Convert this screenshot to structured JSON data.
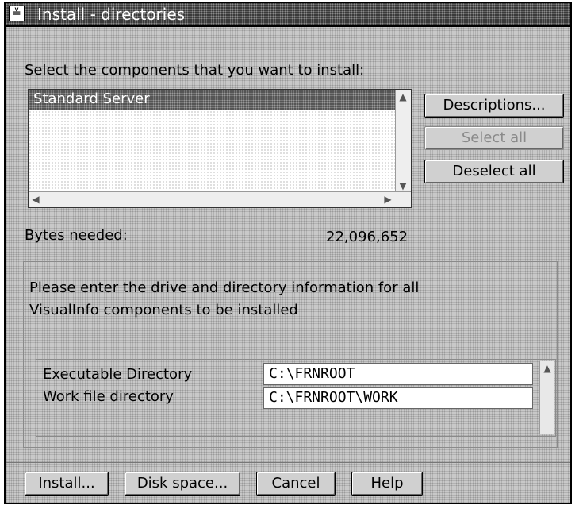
{
  "window": {
    "title": "Install - directories",
    "sysmenu_glyph": "≚"
  },
  "components": {
    "prompt": "Select the components that you want to install:",
    "items": [
      "Standard Server"
    ],
    "selected": "Standard Server"
  },
  "buttons_side": {
    "descriptions": "Descriptions...",
    "select_all": "Select all",
    "deselect_all": "Deselect all"
  },
  "bytes": {
    "label": "Bytes needed:",
    "value": "22,096,652"
  },
  "directories": {
    "instructions_line1": "Please enter the drive and directory information for all",
    "instructions_line2": "VisualInfo components to be installed",
    "fields": [
      {
        "label": "Executable Directory",
        "value": "C:\\FRNROOT"
      },
      {
        "label": "Work file directory",
        "value": "C:\\FRNROOT\\WORK"
      }
    ]
  },
  "buttons_bottom": {
    "install": "Install...",
    "disk_space": "Disk space...",
    "cancel": "Cancel",
    "help": "Help"
  },
  "icons": [
    "system-menu-icon",
    "scroll-up-arrow-icon",
    "scroll-down-arrow-icon",
    "scroll-left-arrow-icon",
    "scroll-right-arrow-icon"
  ],
  "colors": {
    "titlebar": "#3a3a3a",
    "face": "#c8c8c8",
    "selection": "#555555"
  }
}
